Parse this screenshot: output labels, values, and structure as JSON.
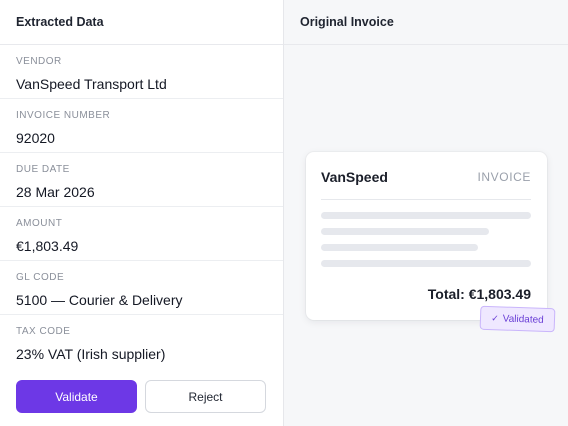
{
  "left_panel": {
    "title": "Extracted Data",
    "fields": [
      {
        "label": "VENDOR",
        "value": "VanSpeed Transport Ltd"
      },
      {
        "label": "INVOICE NUMBER",
        "value": "92020"
      },
      {
        "label": "DUE DATE",
        "value": "28 Mar 2026"
      },
      {
        "label": "AMOUNT",
        "value": "€1,803.49"
      },
      {
        "label": "GL CODE",
        "value": "5100 — Courier & Delivery"
      },
      {
        "label": "TAX CODE",
        "value": "23% VAT (Irish supplier)"
      }
    ],
    "actions": {
      "validate_label": "Validate",
      "reject_label": "Reject"
    }
  },
  "right_panel": {
    "title": "Original Invoice",
    "card": {
      "vendor": "VanSpeed",
      "doc_type": "INVOICE",
      "total": "Total: €1,803.49"
    },
    "stamp": {
      "icon": "check-icon",
      "label": "Validated"
    }
  },
  "colors": {
    "primary": "#6d38e6",
    "stamp_bg": "#efe8ff",
    "stamp_text": "#6a3fd6"
  }
}
